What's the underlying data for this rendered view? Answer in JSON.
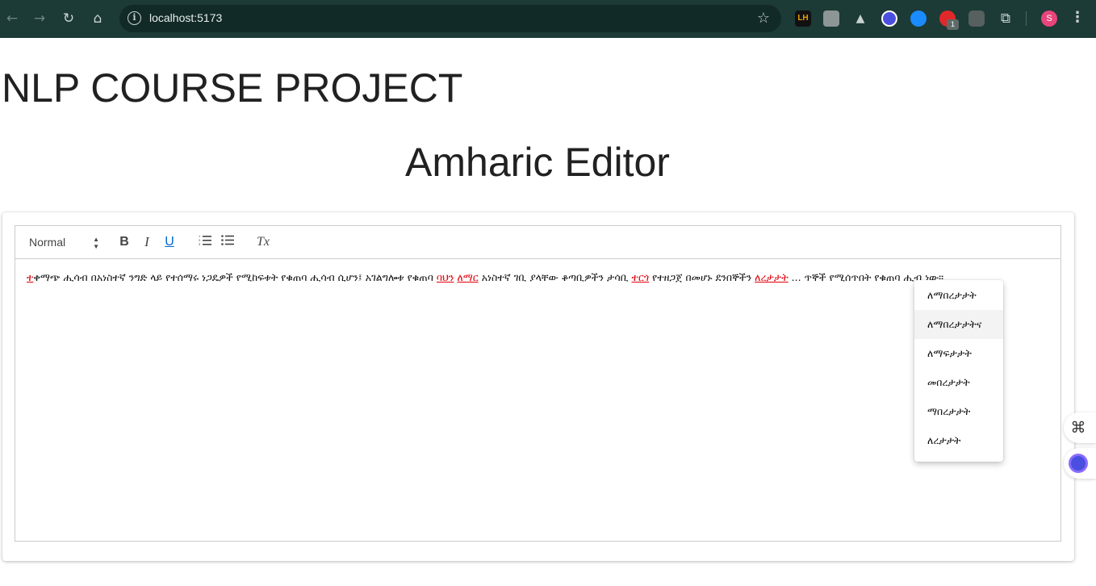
{
  "browser": {
    "url": "localhost:5173",
    "badge_count": "1",
    "profile_initial": "S",
    "extension_lh_label": "LH",
    "icons": [
      "back-icon",
      "forward-icon",
      "reload-icon",
      "home-icon",
      "info-icon",
      "bookmark-star-icon",
      "extensions-icon",
      "menu-icon"
    ]
  },
  "page": {
    "project_title": "NLP COURSE PROJECT",
    "editor_title": "Amharic Editor"
  },
  "toolbar": {
    "format_value": "Normal",
    "bold_label": "B",
    "italic_label": "I",
    "underline_label": "U",
    "ordered_list_icon": "ordered-list-icon",
    "bullet_list_icon": "bullet-list-icon",
    "clear_format_label": "Tx"
  },
  "editor": {
    "segments": [
      {
        "text": "ተ",
        "error": true
      },
      {
        "text": "ቀማጭ ሒሳብ በአነስተኛ ንግድ ላይ የተሰማሩ ነጋዴዎች የሚከፍቱት የቁጠባ ሒሳብ ሲሆን፤ አገልግሎቱ የቁጠባ ",
        "error": false
      },
      {
        "text": "ባህን",
        "error": true
      },
      {
        "text": " ",
        "error": false
      },
      {
        "text": "ለማር",
        "error": true
      },
      {
        "text": " አነስተኛ ገቢ ያላቸው ቆጣቢዎችን ታሳቢ ",
        "error": false
      },
      {
        "text": "ተርጎ",
        "error": true
      },
      {
        "text": " የተዘጋጀ በመሆኑ ደንበኞችን ",
        "error": false
      },
      {
        "text": "ለረታታት",
        "error": true
      },
      {
        "text": " ... ጥኞች የሚሰጥበት የቁጠባ ሒብ ነው፡፡",
        "error": false
      }
    ]
  },
  "suggestions": {
    "items": [
      "ለማበረታታት",
      "ለማበረታታትና",
      "ለማፍታታት",
      "መበረታታት",
      "ማበረታታት",
      "ለረታታት"
    ],
    "highlighted_index": 1
  },
  "colors": {
    "chrome_bg": "#1c3a36",
    "error_red": "#e0000b",
    "link_blue": "#0066cc"
  }
}
